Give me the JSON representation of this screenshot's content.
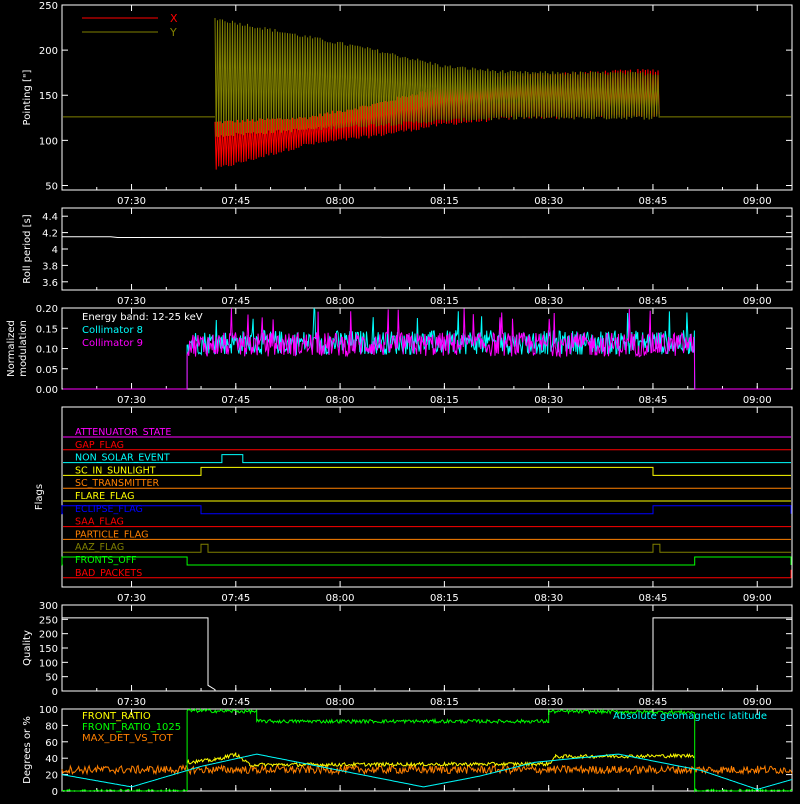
{
  "time_axis": {
    "start": "07:20",
    "end": "09:05",
    "ticks": [
      "07:30",
      "07:45",
      "08:00",
      "08:15",
      "08:30",
      "08:45",
      "09:00"
    ]
  },
  "colors": {
    "background": "#000000",
    "axes": "#ffffff",
    "red": "#ff0000",
    "olive": "#808000",
    "cyan": "#00ffff",
    "magenta": "#ff00ff",
    "green": "#00ff00",
    "yellow": "#ffff00",
    "orange": "#ff8000",
    "blue": "#0000ff",
    "orange_red": "#ff4000"
  },
  "chart_data": [
    {
      "type": "line",
      "id": "pointing",
      "ylabel": "Pointing [\"]",
      "ylim": [
        45,
        250
      ],
      "yticks": [
        50,
        100,
        150,
        200,
        250
      ],
      "legend": [
        "X",
        "Y"
      ],
      "legend_position": "top-left",
      "series": [
        {
          "name": "X",
          "color": "#ff0000",
          "active_start": "07:42",
          "active_end": "08:46",
          "envelope_upper": [
            [
              "07:42",
              120
            ],
            [
              "07:55",
              125
            ],
            [
              "08:05",
              140
            ],
            [
              "08:15",
              160
            ],
            [
              "08:25",
              172
            ],
            [
              "08:46",
              178
            ]
          ],
          "envelope_lower": [
            [
              "07:42",
              68
            ],
            [
              "07:55",
              95
            ],
            [
              "08:05",
              105
            ],
            [
              "08:15",
              118
            ],
            [
              "08:25",
              125
            ],
            [
              "08:46",
              128
            ]
          ],
          "fill_before": 126,
          "fill_after": 126
        },
        {
          "name": "Y",
          "color": "#808000",
          "active_start": "07:42",
          "active_end": "08:46",
          "envelope_upper": [
            [
              "07:42",
              235
            ],
            [
              "07:55",
              215
            ],
            [
              "08:05",
              200
            ],
            [
              "08:15",
              182
            ],
            [
              "08:25",
              175
            ],
            [
              "08:46",
              174
            ]
          ],
          "envelope_lower": [
            [
              "07:42",
              105
            ],
            [
              "07:55",
              112
            ],
            [
              "08:05",
              117
            ],
            [
              "08:15",
              122
            ],
            [
              "08:25",
              125
            ],
            [
              "08:46",
              125
            ]
          ],
          "fill_before": 126,
          "fill_after": 126
        }
      ]
    },
    {
      "type": "line",
      "id": "roll_period",
      "ylabel": "Roll period [s]",
      "ylim": [
        3.5,
        4.5
      ],
      "yticks": [
        3.6,
        3.8,
        4.0,
        4.2,
        4.4
      ],
      "series": [
        {
          "name": "",
          "color": "#ffffff",
          "x": [
            "07:20",
            "07:27",
            "07:28",
            "09:05"
          ],
          "y": [
            4.15,
            4.15,
            4.14,
            4.15
          ]
        }
      ]
    },
    {
      "type": "line",
      "id": "modulation",
      "ylabel": "Normalized modulation",
      "ylim": [
        0,
        0.2
      ],
      "yticks": [
        "0.00",
        "0.05",
        "0.10",
        "0.15",
        "0.20"
      ],
      "annotations": [
        "Energy band: 12-25 keV"
      ],
      "legend": [
        "Collimator 8",
        "Collimator 9"
      ],
      "legend_position": "top-left",
      "series": [
        {
          "name": "Collimator 8",
          "color": "#00ffff",
          "active_start": "07:38",
          "active_end": "08:51",
          "base": 0.115,
          "noise": 0.03
        },
        {
          "name": "Collimator 9",
          "color": "#ff00ff",
          "active_start": "07:38",
          "active_end": "08:51",
          "base": 0.11,
          "noise": 0.03
        }
      ]
    },
    {
      "type": "line",
      "id": "flags",
      "ylabel": "Flags",
      "flags": [
        {
          "name": "ATTENUATOR_STATE",
          "color": "#ff00ff",
          "high": []
        },
        {
          "name": "GAP_FLAG",
          "color": "#ff0000",
          "high": []
        },
        {
          "name": "NON_SOLAR_EVENT",
          "color": "#00ffff",
          "high": [
            [
              "07:43",
              "07:46"
            ]
          ]
        },
        {
          "name": "SC_IN_SUNLIGHT",
          "color": "#ffff00",
          "high": [
            [
              "07:40",
              "08:45"
            ]
          ]
        },
        {
          "name": "SC_TRANSMITTER",
          "color": "#ff8000",
          "high": []
        },
        {
          "name": "FLARE_FLAG",
          "color": "#ffff00",
          "high": []
        },
        {
          "name": "ECLIPSE_FLAG",
          "color": "#0000ff",
          "high": [
            [
              "07:20",
              "07:40"
            ],
            [
              "08:45",
              "09:05"
            ]
          ]
        },
        {
          "name": "SAA_FLAG",
          "color": "#ff0000",
          "high": []
        },
        {
          "name": "PARTICLE_FLAG",
          "color": "#ff8000",
          "high": []
        },
        {
          "name": "AAZ_FLAG",
          "color": "#808000",
          "high": [
            [
              "07:40",
              "07:41"
            ],
            [
              "08:45",
              "08:46"
            ]
          ]
        },
        {
          "name": "FRONTS_OFF",
          "color": "#00ff00",
          "high": [
            [
              "07:20",
              "07:38"
            ],
            [
              "08:51",
              "09:05"
            ]
          ]
        },
        {
          "name": "BAD_PACKETS",
          "color": "#ff0000",
          "high": [
            [
              "09:05",
              "09:05"
            ]
          ]
        }
      ]
    },
    {
      "type": "line",
      "id": "quality",
      "ylabel": "Quality",
      "ylim": [
        0,
        300
      ],
      "yticks": [
        0,
        50,
        100,
        150,
        200,
        250,
        300
      ],
      "series": [
        {
          "name": "",
          "color": "#ffffff",
          "x": [
            "07:20",
            "07:41",
            "07:41",
            "07:42",
            "07:42",
            "08:45",
            "08:45",
            "09:05"
          ],
          "y": [
            255,
            255,
            20,
            5,
            0,
            0,
            255,
            255
          ]
        }
      ]
    },
    {
      "type": "line",
      "id": "degrees",
      "ylabel": "Degrees or %",
      "ylim": [
        0,
        100
      ],
      "yticks": [
        0,
        20,
        40,
        60,
        80,
        100
      ],
      "legend": [
        "FRONT_RATIO",
        "FRONT_RATIO_1025",
        "MAX_DET_VS_TOT",
        "Absolute geomagnetic latitude"
      ],
      "legend_position": "top-left",
      "series": [
        {
          "name": "FRONT_RATIO",
          "color": "#ffff00",
          "x": [
            "07:38",
            "07:42",
            "07:45",
            "07:46",
            "07:47",
            "08:30",
            "08:31",
            "08:51"
          ],
          "y": [
            35,
            38,
            45,
            38,
            32,
            33,
            42,
            43
          ]
        },
        {
          "name": "FRONT_RATIO_1025",
          "color": "#00ff00",
          "x": [
            "07:20",
            "07:38",
            "07:38",
            "07:48",
            "07:48",
            "08:30",
            "08:30",
            "08:51",
            "08:51",
            "09:05"
          ],
          "y": [
            0,
            0,
            98,
            97,
            85,
            85,
            97,
            96,
            0,
            0
          ]
        },
        {
          "name": "MAX_DET_VS_TOT",
          "color": "#ff8000",
          "base": 26,
          "noise": 5
        },
        {
          "name": "Absolute geomagnetic latitude",
          "color": "#00ffff",
          "x": [
            "07:20",
            "07:30",
            "07:40",
            "07:48",
            "08:00",
            "08:12",
            "08:20",
            "08:28",
            "08:40",
            "08:52",
            "09:00",
            "09:05"
          ],
          "y": [
            20,
            5,
            30,
            45,
            25,
            5,
            18,
            35,
            45,
            25,
            2,
            14
          ]
        }
      ]
    }
  ]
}
